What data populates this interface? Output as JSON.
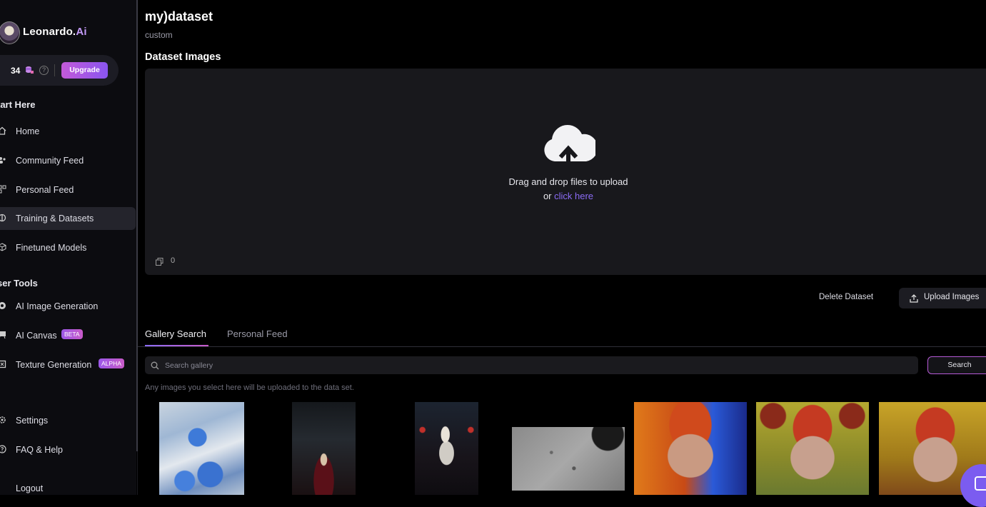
{
  "sidebar": {
    "brand_name": "Leonardo.",
    "brand_ai": "Ai",
    "tokens": "34",
    "upgrade_label": "Upgrade",
    "section_start": "tart Here",
    "items_start": [
      {
        "label": "Home",
        "icon": "home-icon"
      },
      {
        "label": "Community Feed",
        "icon": "community-icon"
      },
      {
        "label": "Personal Feed",
        "icon": "grid-icon"
      },
      {
        "label": "Training & Datasets",
        "icon": "training-icon",
        "active": true
      },
      {
        "label": "Finetuned Models",
        "icon": "cube-icon"
      }
    ],
    "section_tools": "ser Tools",
    "items_tools": [
      {
        "label": "AI Image Generation",
        "icon": "image-gen-icon"
      },
      {
        "label": "AI Canvas",
        "icon": "canvas-icon",
        "badge": "BETA"
      },
      {
        "label": "Texture Generation",
        "icon": "texture-icon",
        "badge": "ALPHA"
      }
    ],
    "items_bottom": [
      {
        "label": "Settings",
        "icon": "gear-icon"
      },
      {
        "label": "FAQ & Help",
        "icon": "help-icon"
      },
      {
        "label": "Logout",
        "icon": "logout-icon"
      }
    ]
  },
  "main": {
    "title": "my)dataset",
    "subtitle": "custom",
    "section_title": "Dataset Images",
    "drop_line1": "Drag and drop files to upload",
    "drop_or": "or ",
    "drop_link": "click here",
    "image_count": "0",
    "delete_label": "Delete Dataset",
    "upload_label": "Upload Images",
    "tabs": [
      {
        "label": "Gallery Search",
        "active": true
      },
      {
        "label": "Personal Feed",
        "active": false
      }
    ],
    "search_placeholder": "Search gallery",
    "search_button": "Search",
    "hint": "Any images you select here will be uploaded to the data set."
  },
  "colors": {
    "accent_purple": "#8b6cf5",
    "accent_pink": "#c85ac8",
    "brand_ai": "#c39af7"
  }
}
